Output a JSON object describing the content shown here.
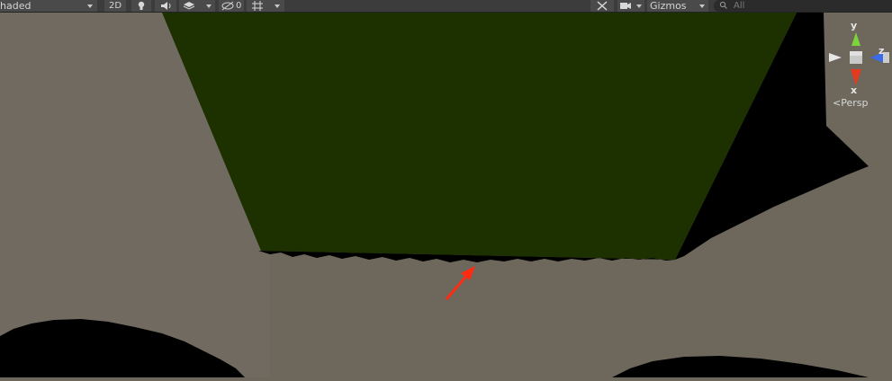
{
  "toolbar": {
    "draw_mode": "haded",
    "mode_2d": "2D",
    "hidden_count": "0",
    "gizmos": "Gizmos",
    "search_placeholder": "All"
  },
  "gizmo": {
    "y": "y",
    "z": "z",
    "x": "x",
    "projection": "Persp"
  },
  "colors": {
    "ground": "#6d675c",
    "plane": "#1d3100",
    "shadow": "#000000",
    "arrow": "#ff2a10",
    "toolbar": "#3c3c3c"
  }
}
